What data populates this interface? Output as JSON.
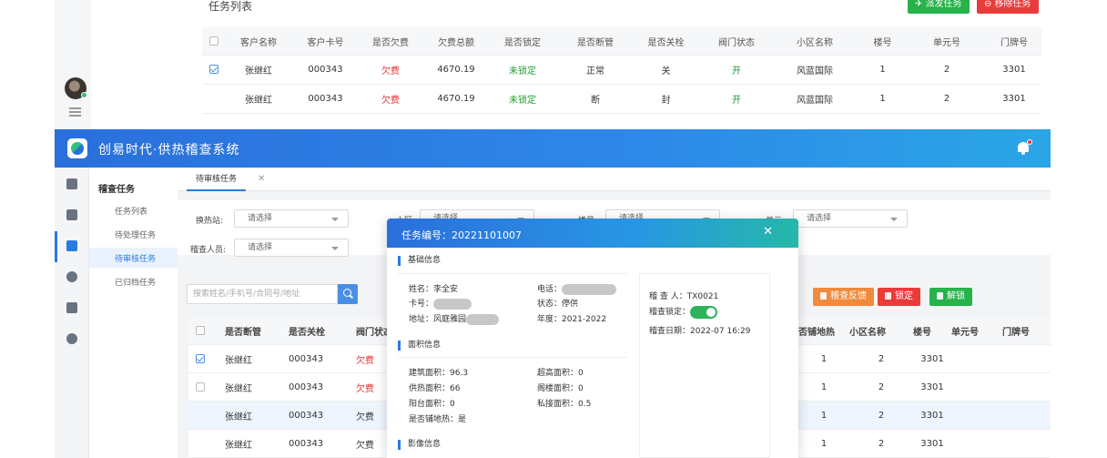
{
  "top": {
    "title": "任务列表",
    "dispatch_btn": "派发任务",
    "remove_btn": "移除任务",
    "columns": [
      "客户名称",
      "客户卡号",
      "是否欠费",
      "欠费总额",
      "是否锁定",
      "是否断管",
      "是否关栓",
      "阀门状态",
      "小区名称",
      "楼号",
      "单元号",
      "门牌号"
    ],
    "rows": [
      {
        "checked": true,
        "cells": [
          "张继红",
          "000343",
          "欠费",
          "4670.19",
          "未锁定",
          "正常",
          "关",
          "开",
          "风蓝国际",
          "1",
          "2",
          "3301"
        ]
      },
      {
        "checked": false,
        "cells": [
          "张继红",
          "000343",
          "欠费",
          "4670.19",
          "未锁定",
          "断",
          "封",
          "开",
          "风蓝国际",
          "1",
          "2",
          "3301"
        ]
      }
    ]
  },
  "header": {
    "app_title": "创易时代·供热稽查系统"
  },
  "sidemenu": {
    "group": "稽查任务",
    "items": [
      "任务列表",
      "待处理任务",
      "待审核任务",
      "已归档任务"
    ]
  },
  "tabs": [
    {
      "label": "待审核任务"
    }
  ],
  "filters": {
    "station_label": "换热站:",
    "station_placeholder": "请选择",
    "district_label": "小区:",
    "district_placeholder": "请选择",
    "building_label": "楼号:",
    "building_placeholder": "请选择",
    "unit_label": "单元:",
    "unit_placeholder": "请选择",
    "inspector_label": "稽查人员:",
    "inspector_placeholder": "请选择"
  },
  "search": {
    "placeholder": "搜索姓名/手机号/合同号/地址"
  },
  "actions": {
    "feedback": "稽查反馈",
    "lock": "锁定",
    "unlock": "解锁"
  },
  "main_table": {
    "columns": [
      "是否断管",
      "是否关栓",
      "阀门状态",
      "否铺地热",
      "小区名称",
      "楼号",
      "单元号",
      "门牌号"
    ],
    "rows": [
      {
        "checked": true,
        "cells": [
          "张继红",
          "000343",
          "欠费",
          "1",
          "2",
          "3301"
        ],
        "red": true
      },
      {
        "checked": false,
        "cells": [
          "张继红",
          "000343",
          "欠费",
          "1",
          "2",
          "3301"
        ],
        "red": true
      },
      {
        "checked": null,
        "cells": [
          "张继红",
          "000343",
          "欠费",
          "1",
          "2",
          "3301"
        ],
        "red": false
      },
      {
        "checked": null,
        "cells": [
          "张继红",
          "000343",
          "欠费",
          "1",
          "2",
          "3301"
        ],
        "red": false
      }
    ]
  },
  "modal": {
    "title": "任务编号：20221101007",
    "basic_section": "基础信息",
    "name": "姓名：李全安",
    "phone": "电话：",
    "card": "卡号：",
    "status": "状态：停供",
    "address": "地址：风庭雅园",
    "year": "年度：2021-2022",
    "area_section": "面积信息",
    "build_area": "建筑面积：96.3",
    "over_area": "超高面积：0",
    "heat_area": "供热面积：66",
    "attic_area": "阁楼面积：0",
    "balcony_area": "阳台面积：0",
    "private_area": "私接面积：0.5",
    "floor_heat": "是否铺地热：是",
    "image_section": "影像信息",
    "inspector": "稽  查  人：TX0021",
    "lock_label": "稽查锁定：",
    "date": "稽查日期：2022-07 16:29"
  }
}
